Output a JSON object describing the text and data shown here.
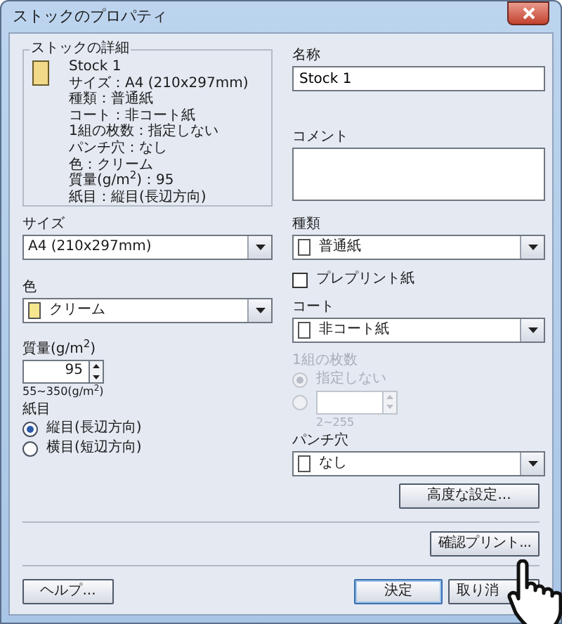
{
  "window": {
    "title": "ストックのプロパティ"
  },
  "details": {
    "title": "ストックの詳細",
    "lines": [
      "Stock 1",
      "サイズ：A4 (210x297mm)",
      "種類：普通紙",
      "コート：非コート紙",
      "1組の枚数：指定しない",
      "パンチ穴：なし",
      "色：クリーム",
      "質量(g/m$^{2}$)：95",
      "紙目：縦目(長辺方向)"
    ]
  },
  "name": {
    "label": "名称",
    "value": "Stock 1"
  },
  "comment": {
    "label": "コメント"
  },
  "size": {
    "label": "サイズ",
    "value": "A4 (210x297mm)"
  },
  "color": {
    "label": "色",
    "value": "クリーム"
  },
  "weight": {
    "label": "質量(g/m$^{2}$)",
    "value": "95",
    "range": "55~350(g/m$^{2}$)"
  },
  "grain": {
    "label": "紙目",
    "options": [
      {
        "label": "縦目(長辺方向)",
        "selected": true
      },
      {
        "label": "横目(短辺方向)",
        "selected": false
      }
    ]
  },
  "type": {
    "label": "種類",
    "value": "普通紙"
  },
  "preprinted": {
    "label": "プレプリント紙",
    "checked": false
  },
  "coating": {
    "label": "コート",
    "value": "非コート紙"
  },
  "sheets": {
    "label": "1組の枚数",
    "disabled": true,
    "range": "2~255",
    "options": [
      {
        "kind": "radio",
        "label": "指定しない",
        "selected": true
      },
      {
        "kind": "spin",
        "selected": false
      }
    ]
  },
  "punch": {
    "label": "パンチ穴",
    "value": "なし"
  },
  "buttons": {
    "advanced": "高度な設定...",
    "proof": "確認プリント...",
    "help": "ヘルプ...",
    "ok": "決定",
    "cancel": "取り消"
  }
}
